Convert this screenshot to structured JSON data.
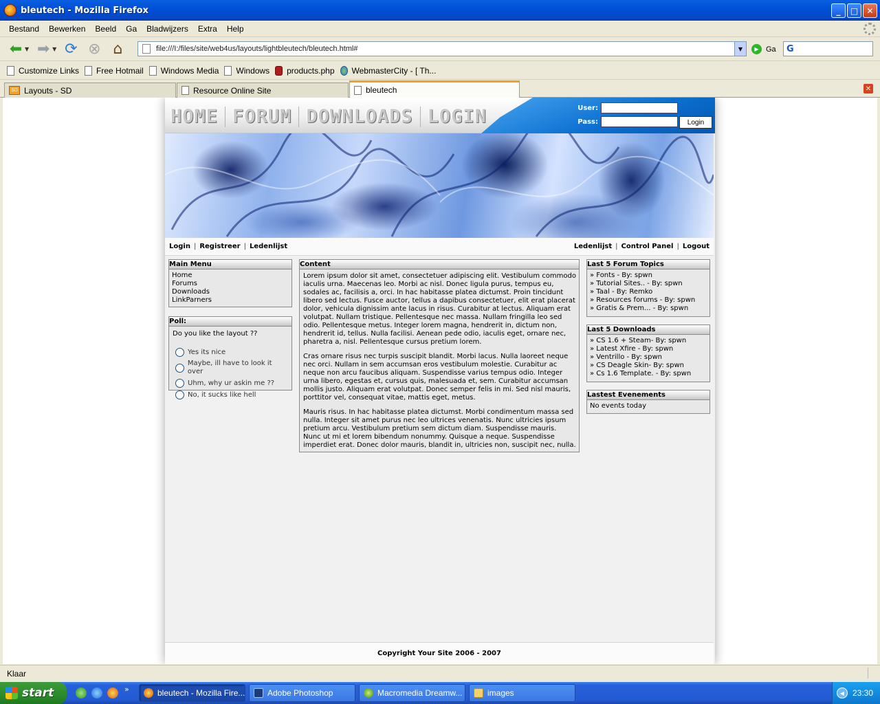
{
  "window": {
    "title": "bleutech - Mozilla Firefox"
  },
  "menu": [
    "Bestand",
    "Bewerken",
    "Beeld",
    "Ga",
    "Bladwijzers",
    "Extra",
    "Help"
  ],
  "nav": {
    "url": "file:///I:/files/site/web4us/layouts/lightbleutech/bleutech.html#",
    "go_label": "Ga"
  },
  "bookmarks": [
    "Customize Links",
    "Free Hotmail",
    "Windows Media",
    "Windows",
    "products.php",
    "WebmasterCity - [ Th..."
  ],
  "tabs": [
    "Layouts - SD",
    "Resource Online Site",
    "bleutech"
  ],
  "site": {
    "topnav": [
      "HOME",
      "FORUM",
      "DOWNLOADS",
      "LOGIN"
    ],
    "login": {
      "user_label": "User:",
      "pass_label": "Pass:",
      "button": "Login"
    },
    "subnav_left": [
      "Login",
      "Registreer",
      "Ledenlijst"
    ],
    "subnav_right": [
      "Ledenlijst",
      "Control Panel",
      "Logout"
    ],
    "main_menu": {
      "title": "Main Menu",
      "items": [
        "Home",
        "Forums",
        "Downloads",
        "LinkParners"
      ]
    },
    "poll": {
      "title": "Poll:",
      "question": "Do you like the layout ??",
      "options": [
        "Yes its nice",
        "Maybe, ill have to look it over",
        "Uhm, why ur askin me ??",
        "No, it sucks like hell"
      ]
    },
    "content": {
      "title": "Content",
      "paragraphs": [
        "Lorem ipsum dolor sit amet, consectetuer adipiscing elit. Vestibulum commodo iaculis urna. Maecenas leo. Morbi ac nisl. Donec ligula purus, tempus eu, sodales ac, facilisis a, orci. In hac habitasse platea dictumst. Proin tincidunt libero sed lectus. Fusce auctor, tellus a dapibus consectetuer, elit erat placerat dolor, vehicula dignissim ante lacus in risus. Curabitur at lectus. Aliquam erat volutpat. Nullam tristique. Pellentesque nec massa. Nullam fringilla leo sed odio. Pellentesque metus. Integer lorem magna, hendrerit in, dictum non, hendrerit id, tellus. Nulla facilisi. Aenean pede odio, iaculis eget, ornare nec, pharetra a, nisl. Pellentesque cursus pretium lorem.",
        "Cras ornare risus nec turpis suscipit blandit. Morbi lacus. Nulla laoreet neque nec orci. Nullam in sem accumsan eros vestibulum molestie. Curabitur ac neque non arcu faucibus aliquam. Suspendisse varius tempus odio. Integer urna libero, egestas et, cursus quis, malesuada et, sem. Curabitur accumsan mollis justo. Aliquam erat volutpat. Donec semper felis in mi. Sed nisl mauris, porttitor vel, consequat vitae, mattis eget, metus.",
        "Mauris risus. In hac habitasse platea dictumst. Morbi condimentum massa sed nulla. Integer sit amet purus nec leo ultrices venenatis. Nunc ultricies ipsum pretium arcu. Vestibulum pretium sem dictum diam. Suspendisse mauris. Nunc ut mi et lorem bibendum nonummy. Quisque a neque. Suspendisse imperdiet erat. Donec dolor mauris, blandit in, ultricies non, suscipit nec, nulla."
      ]
    },
    "forum_topics": {
      "title": "Last 5 Forum Topics",
      "items": [
        "» Fonts - By: spwn",
        "» Tutorial Sites.. - By: spwn",
        "» Taal - By: Remko",
        "» Resources forums - By: spwn",
        "» Gratis & Prem... - By: spwn"
      ]
    },
    "downloads": {
      "title": "Last 5 Downloads",
      "items": [
        "» CS 1.6 + Steam- By: spwn",
        "» Latest Xfire - By: spwn",
        "» Ventrillo - By: spwn",
        "» CS Deagle Skin- By: spwn",
        "» Cs 1.6 Template. - By: spwn"
      ]
    },
    "events": {
      "title": "Lastest Evenements",
      "text": "No events today"
    },
    "footer": "Copyright Your Site 2006 - 2007"
  },
  "status": "Klaar",
  "taskbar": {
    "start": "start",
    "items": [
      "bleutech - Mozilla Fire...",
      "Adobe Photoshop",
      "Macromedia Dreamw...",
      "images"
    ],
    "clock": "23:30"
  }
}
